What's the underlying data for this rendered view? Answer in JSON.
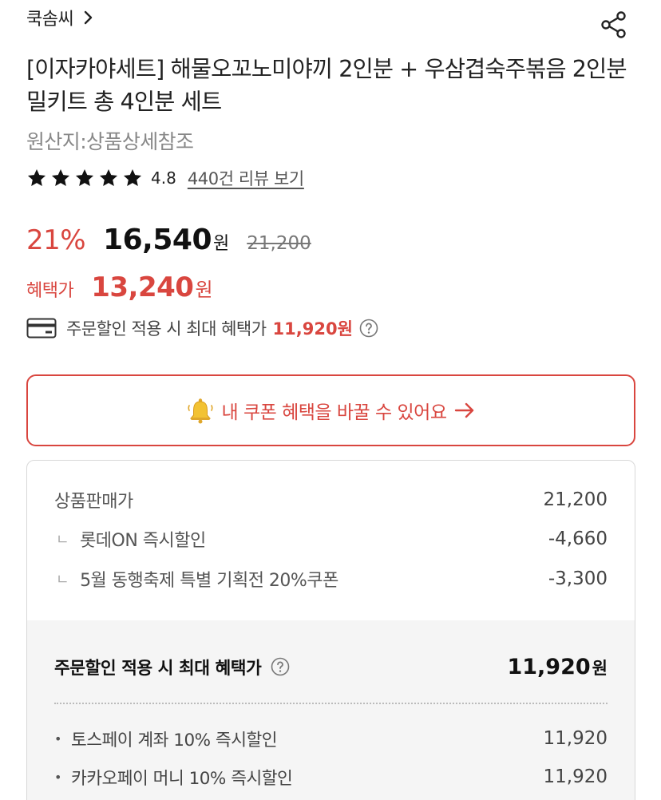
{
  "header": {
    "store_name": "쿡솜씨",
    "store_chevron_icon": "chevron-right-icon",
    "share_icon": "share-icon"
  },
  "product": {
    "title": "[이자카야세트] 해물오꼬노미야끼 2인분 + 우삼겹숙주볶음 2인분 밀키트 총 4인분 세트",
    "origin": "원산지:상품상세참조",
    "rating": {
      "stars": 5,
      "value": "4.8",
      "review_link": "440건 리뷰 보기"
    }
  },
  "price": {
    "discount_rate": "21%",
    "sale_price": "16,540",
    "unit": "원",
    "original_price": "21,200",
    "benefit_label": "혜택가",
    "benefit_price": "13,240",
    "benefit_unit": "원",
    "max_benefit_text": "주문할인 적용 시 최대 혜택가",
    "max_benefit_price": "11,920원"
  },
  "coupon_button": {
    "label": "내 쿠폰 혜택을 바꿀 수 있어요",
    "icon": "bell-icon",
    "arrow_icon": "arrow-right-icon"
  },
  "breakdown": {
    "lines": [
      {
        "label": "상품판매가",
        "value": "21,200",
        "sub": false
      },
      {
        "label": "롯데ON 즉시할인",
        "value": "-4,660",
        "sub": true
      },
      {
        "label": "5월 동행축제 특별 기획전 20%쿠폰",
        "value": "-3,300",
        "sub": true
      }
    ],
    "sub_mark": "ㄴ",
    "total_label": "주문할인 적용 시 최대 혜택가",
    "total_value": "11,920",
    "total_unit": "원",
    "payments": [
      {
        "label": "토스페이 계좌 10% 즉시할인",
        "value": "11,920"
      },
      {
        "label": "카카오페이 머니 10% 즉시할인",
        "value": "11,920"
      }
    ],
    "bullet": "•"
  },
  "colors": {
    "accent": "#d9463f",
    "text": "#222222",
    "muted": "#888888",
    "panel_bg": "#f5f5f5"
  }
}
